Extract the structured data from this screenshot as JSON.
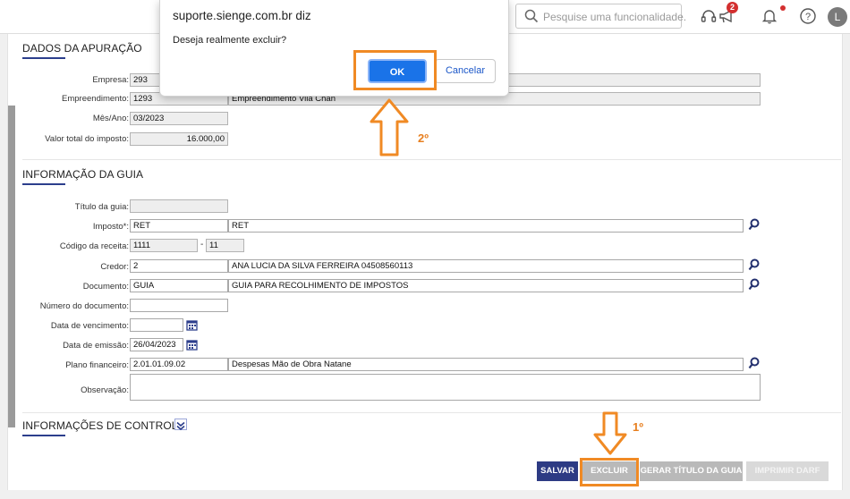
{
  "topbar": {
    "search_placeholder": "Pesquise uma funcionalidade.",
    "notification_count": "2",
    "avatar_initial": "L"
  },
  "dialog": {
    "title": "suporte.sienge.com.br diz",
    "message": "Deseja realmente excluir?",
    "ok_label": "OK",
    "cancel_label": "Cancelar"
  },
  "apuracao": {
    "title": "DADOS DA APURAÇÃO",
    "empresa_label": "Empresa:",
    "empresa_code": "293",
    "empresa_name": "",
    "empreendimento_label": "Empreendimento:",
    "empreendimento_code": "1293",
    "empreendimento_name": "Empreendimento Vila Chan",
    "mes_ano_label": "Mês/Ano:",
    "mes_ano": "03/2023",
    "valor_label": "Valor total do imposto:",
    "valor": "16.000,00"
  },
  "guia": {
    "title": "INFORMAÇÃO DA GUIA",
    "titulo_label": "Título da guia:",
    "titulo": "",
    "imposto_label": "Imposto*:",
    "imposto_code": "RET",
    "imposto_name": "RET",
    "codigo_label": "Código da receita:",
    "codigo_receita": "1111",
    "codigo_suffix": "11",
    "credor_label": "Credor:",
    "credor_code": "2",
    "credor_name": "ANA LUCIA DA SILVA FERREIRA 04508560113",
    "documento_label": "Documento:",
    "documento_code": "GUIA",
    "documento_name": "GUIA PARA RECOLHIMENTO DE IMPOSTOS",
    "numero_label": "Número do documento:",
    "numero": "",
    "vencimento_label": "Data de vencimento:",
    "vencimento": "",
    "emissao_label": "Data de emissão:",
    "emissao": "26/04/2023",
    "plano_label": "Plano financeiro:",
    "plano_code": "2.01.01.09.02",
    "plano_name": "Despesas Mão de Obra Natane",
    "observacao_label": "Observação:",
    "observacao": ""
  },
  "controle": {
    "title": "INFORMAÇÕES DE CONTROLE"
  },
  "actions": {
    "salvar": "SALVAR",
    "excluir": "EXCLUIR",
    "gerar_titulo": "GERAR TÍTULO DA GUIA",
    "imprimir_darf": "IMPRIMIR DARF"
  },
  "annotations": {
    "step1": "1º",
    "step2": "2º",
    "color": "#f08a24"
  }
}
